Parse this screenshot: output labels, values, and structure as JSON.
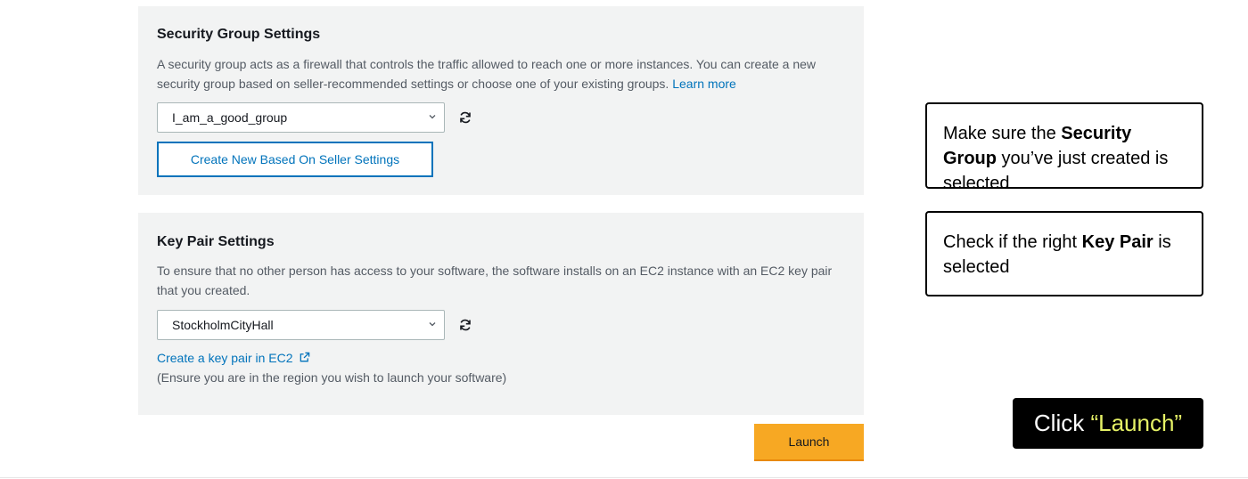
{
  "security_group": {
    "title": "Security Group Settings",
    "description": "A security group acts as a firewall that controls the traffic allowed to reach one or more instances. You can create a new security group based on seller-recommended settings or choose one of your existing groups.",
    "learn_more": "Learn more",
    "selected": "I_am_a_good_group",
    "create_button": "Create New Based On Seller Settings"
  },
  "key_pair": {
    "title": "Key Pair Settings",
    "description": "To ensure that no other person has access to your software, the software installs on an EC2 instance with an EC2 key pair that you created.",
    "selected": "StockholmCityHall",
    "create_link": "Create a key pair in EC2",
    "note": "(Ensure you are in the region you wish to launch your software)"
  },
  "launch_button": "Launch",
  "annotations": {
    "callout1": {
      "pre": "Make sure the ",
      "bold": "Security Group",
      "post": " you’ve just created is selected"
    },
    "callout2": {
      "pre": "Check if the right ",
      "bold": "Key Pair",
      "post": " is selected"
    },
    "callout3": {
      "pre": "Click ",
      "highlight": "“Launch”"
    }
  },
  "colors": {
    "panel_bg": "#f2f3f3",
    "link": "#0073bb",
    "launch_bg": "#f7a823",
    "highlight": "#e6f266"
  },
  "icons": [
    "chevron-down-icon",
    "refresh-icon",
    "external-link-icon"
  ]
}
